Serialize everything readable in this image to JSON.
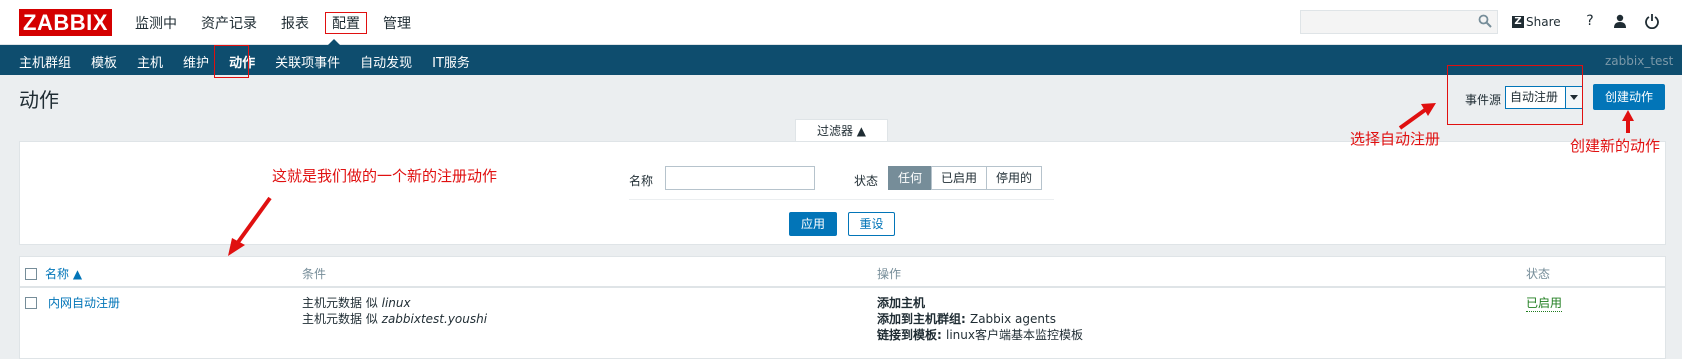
{
  "header": {
    "logo": "ZABBIX",
    "menu": [
      "监测中",
      "资产记录",
      "报表",
      "配置",
      "管理"
    ],
    "active_menu": "配置",
    "share": "Share",
    "help": "?"
  },
  "submenu": {
    "items": [
      "主机群组",
      "模板",
      "主机",
      "维护",
      "动作",
      "关联项事件",
      "自动发现",
      "IT服务"
    ],
    "active": "动作",
    "user": "zabbix_test"
  },
  "page": {
    "title": "动作",
    "event_source_label": "事件源",
    "event_source_value": "自动注册",
    "create_button": "创建动作"
  },
  "filter": {
    "tab": "过滤器 ▲",
    "name_label": "名称",
    "name_value": "",
    "status_label": "状态",
    "status_options": [
      "任何",
      "已启用",
      "停用的"
    ],
    "status_selected": "任何",
    "apply": "应用",
    "reset": "重设"
  },
  "table": {
    "headers": [
      "名称 ▲",
      "条件",
      "操作",
      "状态"
    ],
    "rows": [
      {
        "name": "内网自动注册",
        "conditions": [
          {
            "prefix": "主机元数据 似 ",
            "value": "linux"
          },
          {
            "prefix": "主机元数据 似 ",
            "value": "zabbixtest.youshi"
          }
        ],
        "operations": [
          {
            "label": "添加主机",
            "value": ""
          },
          {
            "label": "添加到主机群组: ",
            "value": "Zabbix agents"
          },
          {
            "label": "链接到模板: ",
            "value": "linux客户端基本监控模板"
          }
        ],
        "status": "已启用"
      }
    ]
  },
  "annotations": {
    "note_registration": "这就是我们做的一个新的注册动作",
    "note_select": "选择自动注册",
    "note_create": "创建新的动作"
  },
  "colors": {
    "brand": "#d40000",
    "nav": "#0e4d6e",
    "primary": "#0275b8",
    "annotation": "#e01010",
    "enabled": "#1f7d1f"
  }
}
